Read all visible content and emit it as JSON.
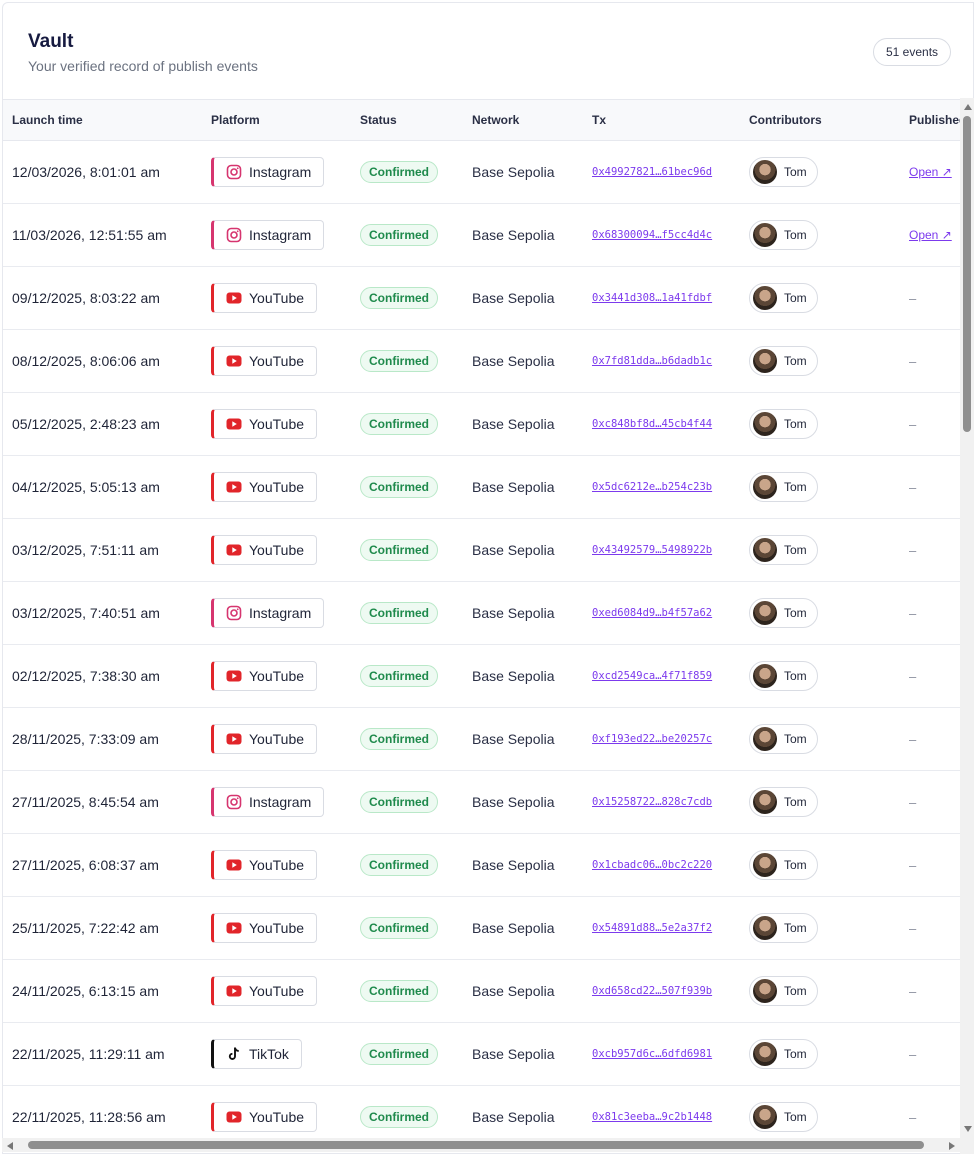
{
  "header": {
    "title": "Vault",
    "subtitle": "Your verified record of publish events",
    "count": "51 events"
  },
  "columns": {
    "launch_time": "Launch time",
    "platform": "Platform",
    "status": "Status",
    "network": "Network",
    "tx": "Tx",
    "contributors": "Contributors",
    "published": "Published"
  },
  "icons": {
    "youtube": "youtube-icon",
    "instagram": "instagram-icon",
    "tiktok": "tiktok-icon",
    "external": "external-link-icon"
  },
  "colors": {
    "youtube": "#e1252a",
    "instagram": "#d6356f",
    "tiktok": "#111111",
    "confirmed": "#1f8a4c",
    "link": "#7c3aed"
  },
  "rows": [
    {
      "time": "12/03/2026, 8:01:01 am",
      "platform": "Instagram",
      "platform_key": "instagram",
      "status": "Confirmed",
      "network": "Base Sepolia",
      "tx": "0x49927821…61bec96d",
      "contributor": "Tom",
      "published": "Open ↗"
    },
    {
      "time": "11/03/2026, 12:51:55 am",
      "platform": "Instagram",
      "platform_key": "instagram",
      "status": "Confirmed",
      "network": "Base Sepolia",
      "tx": "0x68300094…f5cc4d4c",
      "contributor": "Tom",
      "published": "Open ↗"
    },
    {
      "time": "09/12/2025, 8:03:22 am",
      "platform": "YouTube",
      "platform_key": "youtube",
      "status": "Confirmed",
      "network": "Base Sepolia",
      "tx": "0x3441d308…1a41fdbf",
      "contributor": "Tom",
      "published": "–"
    },
    {
      "time": "08/12/2025, 8:06:06 am",
      "platform": "YouTube",
      "platform_key": "youtube",
      "status": "Confirmed",
      "network": "Base Sepolia",
      "tx": "0x7fd81dda…b6dadb1c",
      "contributor": "Tom",
      "published": "–"
    },
    {
      "time": "05/12/2025, 2:48:23 am",
      "platform": "YouTube",
      "platform_key": "youtube",
      "status": "Confirmed",
      "network": "Base Sepolia",
      "tx": "0xc848bf8d…45cb4f44",
      "contributor": "Tom",
      "published": "–"
    },
    {
      "time": "04/12/2025, 5:05:13 am",
      "platform": "YouTube",
      "platform_key": "youtube",
      "status": "Confirmed",
      "network": "Base Sepolia",
      "tx": "0x5dc6212e…b254c23b",
      "contributor": "Tom",
      "published": "–"
    },
    {
      "time": "03/12/2025, 7:51:11 am",
      "platform": "YouTube",
      "platform_key": "youtube",
      "status": "Confirmed",
      "network": "Base Sepolia",
      "tx": "0x43492579…5498922b",
      "contributor": "Tom",
      "published": "–"
    },
    {
      "time": "03/12/2025, 7:40:51 am",
      "platform": "Instagram",
      "platform_key": "instagram",
      "status": "Confirmed",
      "network": "Base Sepolia",
      "tx": "0xed6084d9…b4f57a62",
      "contributor": "Tom",
      "published": "–"
    },
    {
      "time": "02/12/2025, 7:38:30 am",
      "platform": "YouTube",
      "platform_key": "youtube",
      "status": "Confirmed",
      "network": "Base Sepolia",
      "tx": "0xcd2549ca…4f71f859",
      "contributor": "Tom",
      "published": "–"
    },
    {
      "time": "28/11/2025, 7:33:09 am",
      "platform": "YouTube",
      "platform_key": "youtube",
      "status": "Confirmed",
      "network": "Base Sepolia",
      "tx": "0xf193ed22…be20257c",
      "contributor": "Tom",
      "published": "–"
    },
    {
      "time": "27/11/2025, 8:45:54 am",
      "platform": "Instagram",
      "platform_key": "instagram",
      "status": "Confirmed",
      "network": "Base Sepolia",
      "tx": "0x15258722…828c7cdb",
      "contributor": "Tom",
      "published": "–"
    },
    {
      "time": "27/11/2025, 6:08:37 am",
      "platform": "YouTube",
      "platform_key": "youtube",
      "status": "Confirmed",
      "network": "Base Sepolia",
      "tx": "0x1cbadc06…0bc2c220",
      "contributor": "Tom",
      "published": "–"
    },
    {
      "time": "25/11/2025, 7:22:42 am",
      "platform": "YouTube",
      "platform_key": "youtube",
      "status": "Confirmed",
      "network": "Base Sepolia",
      "tx": "0x54891d88…5e2a37f2",
      "contributor": "Tom",
      "published": "–"
    },
    {
      "time": "24/11/2025, 6:13:15 am",
      "platform": "YouTube",
      "platform_key": "youtube",
      "status": "Confirmed",
      "network": "Base Sepolia",
      "tx": "0xd658cd22…507f939b",
      "contributor": "Tom",
      "published": "–"
    },
    {
      "time": "22/11/2025, 11:29:11 am",
      "platform": "TikTok",
      "platform_key": "tiktok",
      "status": "Confirmed",
      "network": "Base Sepolia",
      "tx": "0xcb957d6c…6dfd6981",
      "contributor": "Tom",
      "published": "–"
    },
    {
      "time": "22/11/2025, 11:28:56 am",
      "platform": "YouTube",
      "platform_key": "youtube",
      "status": "Confirmed",
      "network": "Base Sepolia",
      "tx": "0x81c3eeba…9c2b1448",
      "contributor": "Tom",
      "published": "–"
    }
  ]
}
